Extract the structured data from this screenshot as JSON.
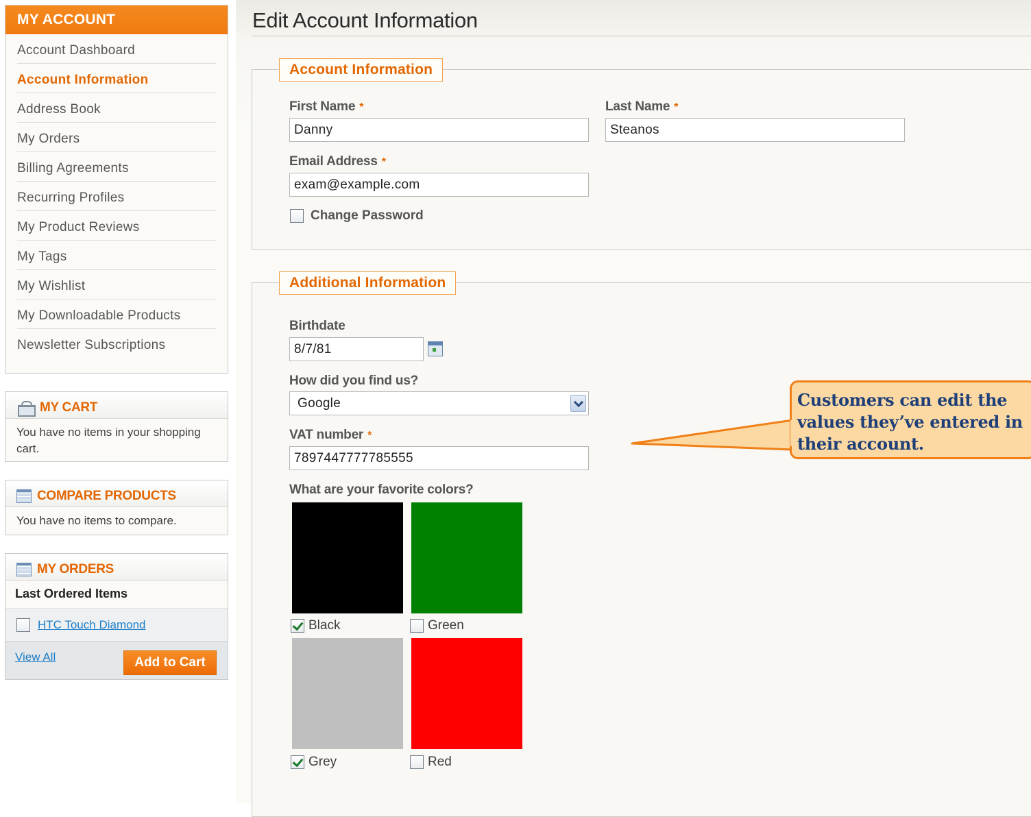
{
  "sidebar": {
    "account": {
      "title": "MY ACCOUNT",
      "items": [
        {
          "label": "Account Dashboard",
          "active": false
        },
        {
          "label": "Account Information",
          "active": true
        },
        {
          "label": "Address Book",
          "active": false
        },
        {
          "label": "My Orders",
          "active": false
        },
        {
          "label": "Billing Agreements",
          "active": false
        },
        {
          "label": "Recurring Profiles",
          "active": false
        },
        {
          "label": "My Product Reviews",
          "active": false
        },
        {
          "label": "My Tags",
          "active": false
        },
        {
          "label": "My Wishlist",
          "active": false
        },
        {
          "label": "My Downloadable Products",
          "active": false
        },
        {
          "label": "Newsletter Subscriptions",
          "active": false
        }
      ]
    },
    "cart": {
      "title": "MY CART",
      "icon": "shopping-cart-icon",
      "message": "You have no items in your shopping cart."
    },
    "compare": {
      "title": "COMPARE PRODUCTS",
      "icon": "grid-list-icon",
      "message": "You have no items to compare."
    },
    "orders": {
      "title": "MY ORDERS",
      "icon": "grid-list-icon",
      "subtitle": "Last Ordered Items",
      "item": "HTC Touch Diamond",
      "item_checked": false,
      "view_all": "View All",
      "add_to_cart": "Add to Cart"
    }
  },
  "main": {
    "title": "Edit Account Information",
    "account_info": {
      "legend": "Account Information",
      "first_name_label": "First Name",
      "first_name": "Danny",
      "last_name_label": "Last Name",
      "last_name": "Steanos",
      "email_label": "Email Address",
      "email": "exam@example.com",
      "change_password": "Change Password",
      "required_mark": "*"
    },
    "additional_info": {
      "legend": "Additional Information",
      "birthdate_label": "Birthdate",
      "birthdate": "8/7/81",
      "find_us_label": "How did you find us?",
      "find_us_value": "Google",
      "vat_label": "VAT number",
      "vat": "7897447777785555",
      "colors_label": "What are your favorite colors?",
      "colors": [
        {
          "name": "Black",
          "hex": "#000000",
          "checked": true
        },
        {
          "name": "Green",
          "hex": "#008000",
          "checked": false
        },
        {
          "name": "Grey",
          "hex": "#bfbfbf",
          "checked": true
        },
        {
          "name": "Red",
          "hex": "#ff0000",
          "checked": false
        }
      ]
    }
  },
  "callout": {
    "text": "Customers can edit the values they’ve entered in their account."
  },
  "colors": {
    "accent": "#e26703",
    "link": "#1e7ec8",
    "callout_bg": "#fcd9a3",
    "callout_border": "#f07f17",
    "callout_text": "#1e3f78"
  }
}
